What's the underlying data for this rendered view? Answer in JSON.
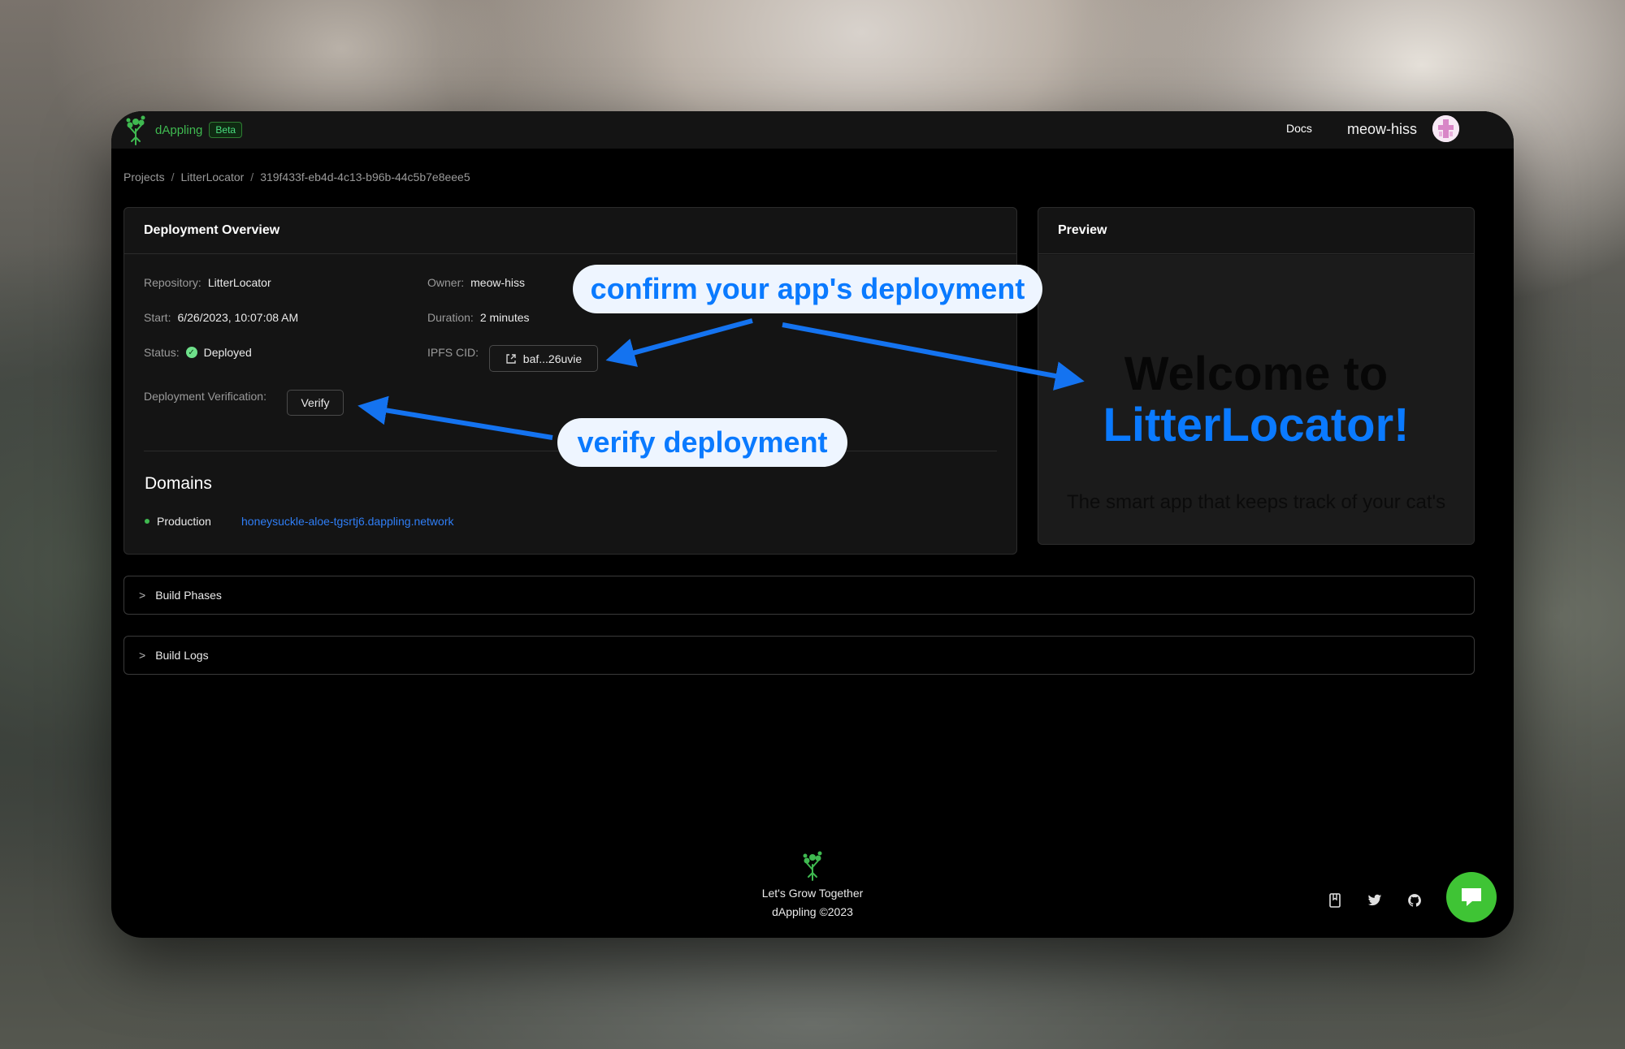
{
  "header": {
    "brand_name": "dAppling",
    "beta_label": "Beta",
    "docs_label": "Docs",
    "user_name": "meow-hiss"
  },
  "breadcrumb": {
    "items": [
      "Projects",
      "LitterLocator",
      "319f433f-eb4d-4c13-b96b-44c5b7e8eee5"
    ],
    "separator": "/"
  },
  "overview": {
    "title": "Deployment Overview",
    "repository_label": "Repository:",
    "repository_value": "LitterLocator",
    "owner_label": "Owner:",
    "owner_value": "meow-hiss",
    "start_label": "Start:",
    "start_value": "6/26/2023, 10:07:08 AM",
    "duration_label": "Duration:",
    "duration_value": "2 minutes",
    "status_label": "Status:",
    "status_value": "Deployed",
    "ipfs_label": "IPFS CID:",
    "ipfs_value": "baf...26uvie",
    "verification_label": "Deployment Verification:",
    "verify_button": "Verify",
    "domains_title": "Domains",
    "domain_env": "Production",
    "domain_url": "honeysuckle-aloe-tgsrtj6.dappling.network"
  },
  "preview": {
    "title": "Preview",
    "welcome_line1": "Welcome to",
    "welcome_line2": "LitterLocator!",
    "subtitle": "The smart app that keeps track of your cat's"
  },
  "accordions": {
    "build_phases": "Build Phases",
    "build_logs": "Build Logs"
  },
  "footer": {
    "tagline": "Let's Grow Together",
    "copyright": "dAppling ©2023"
  },
  "annotations": {
    "confirm": "confirm your app's deployment",
    "verify": "verify deployment"
  },
  "colors": {
    "accent_green": "#3fb950",
    "link_blue": "#2f7ef6",
    "annotation_blue": "#0a7aff",
    "chat_green": "#3fc435"
  },
  "icons": [
    "tree-logo-icon",
    "avatar-icon",
    "check-circle-icon",
    "external-link-icon",
    "chevron-right-icon",
    "book-icon",
    "twitter-icon",
    "github-icon",
    "chat-icon"
  ]
}
